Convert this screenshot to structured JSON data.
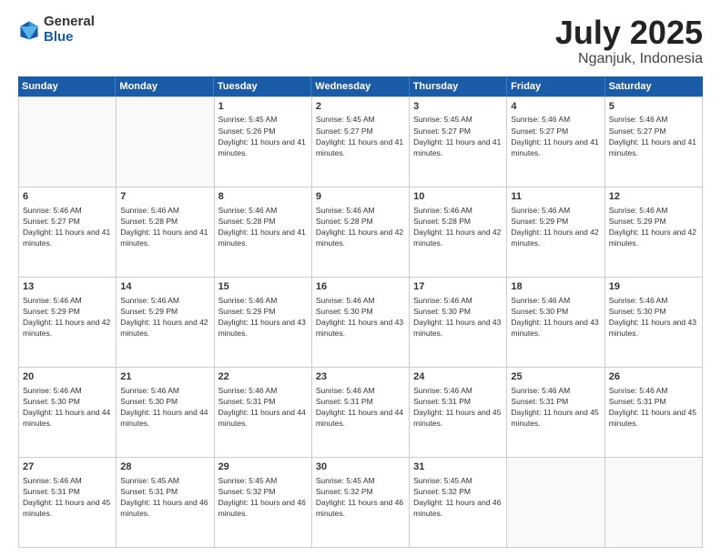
{
  "logo": {
    "general": "General",
    "blue": "Blue"
  },
  "title": "July 2025",
  "location": "Nganjuk, Indonesia",
  "weekdays": [
    "Sunday",
    "Monday",
    "Tuesday",
    "Wednesday",
    "Thursday",
    "Friday",
    "Saturday"
  ],
  "weeks": [
    [
      {
        "day": "",
        "empty": true
      },
      {
        "day": "",
        "empty": true
      },
      {
        "day": "1",
        "sunrise": "5:45 AM",
        "sunset": "5:26 PM",
        "daylight": "11 hours and 41 minutes."
      },
      {
        "day": "2",
        "sunrise": "5:45 AM",
        "sunset": "5:27 PM",
        "daylight": "11 hours and 41 minutes."
      },
      {
        "day": "3",
        "sunrise": "5:45 AM",
        "sunset": "5:27 PM",
        "daylight": "11 hours and 41 minutes."
      },
      {
        "day": "4",
        "sunrise": "5:46 AM",
        "sunset": "5:27 PM",
        "daylight": "11 hours and 41 minutes."
      },
      {
        "day": "5",
        "sunrise": "5:46 AM",
        "sunset": "5:27 PM",
        "daylight": "11 hours and 41 minutes."
      }
    ],
    [
      {
        "day": "6",
        "sunrise": "5:46 AM",
        "sunset": "5:27 PM",
        "daylight": "11 hours and 41 minutes."
      },
      {
        "day": "7",
        "sunrise": "5:46 AM",
        "sunset": "5:28 PM",
        "daylight": "11 hours and 41 minutes."
      },
      {
        "day": "8",
        "sunrise": "5:46 AM",
        "sunset": "5:28 PM",
        "daylight": "11 hours and 41 minutes."
      },
      {
        "day": "9",
        "sunrise": "5:46 AM",
        "sunset": "5:28 PM",
        "daylight": "11 hours and 42 minutes."
      },
      {
        "day": "10",
        "sunrise": "5:46 AM",
        "sunset": "5:28 PM",
        "daylight": "11 hours and 42 minutes."
      },
      {
        "day": "11",
        "sunrise": "5:46 AM",
        "sunset": "5:29 PM",
        "daylight": "11 hours and 42 minutes."
      },
      {
        "day": "12",
        "sunrise": "5:46 AM",
        "sunset": "5:29 PM",
        "daylight": "11 hours and 42 minutes."
      }
    ],
    [
      {
        "day": "13",
        "sunrise": "5:46 AM",
        "sunset": "5:29 PM",
        "daylight": "11 hours and 42 minutes."
      },
      {
        "day": "14",
        "sunrise": "5:46 AM",
        "sunset": "5:29 PM",
        "daylight": "11 hours and 42 minutes."
      },
      {
        "day": "15",
        "sunrise": "5:46 AM",
        "sunset": "5:29 PM",
        "daylight": "11 hours and 43 minutes."
      },
      {
        "day": "16",
        "sunrise": "5:46 AM",
        "sunset": "5:30 PM",
        "daylight": "11 hours and 43 minutes."
      },
      {
        "day": "17",
        "sunrise": "5:46 AM",
        "sunset": "5:30 PM",
        "daylight": "11 hours and 43 minutes."
      },
      {
        "day": "18",
        "sunrise": "5:46 AM",
        "sunset": "5:30 PM",
        "daylight": "11 hours and 43 minutes."
      },
      {
        "day": "19",
        "sunrise": "5:46 AM",
        "sunset": "5:30 PM",
        "daylight": "11 hours and 43 minutes."
      }
    ],
    [
      {
        "day": "20",
        "sunrise": "5:46 AM",
        "sunset": "5:30 PM",
        "daylight": "11 hours and 44 minutes."
      },
      {
        "day": "21",
        "sunrise": "5:46 AM",
        "sunset": "5:30 PM",
        "daylight": "11 hours and 44 minutes."
      },
      {
        "day": "22",
        "sunrise": "5:46 AM",
        "sunset": "5:31 PM",
        "daylight": "11 hours and 44 minutes."
      },
      {
        "day": "23",
        "sunrise": "5:46 AM",
        "sunset": "5:31 PM",
        "daylight": "11 hours and 44 minutes."
      },
      {
        "day": "24",
        "sunrise": "5:46 AM",
        "sunset": "5:31 PM",
        "daylight": "11 hours and 45 minutes."
      },
      {
        "day": "25",
        "sunrise": "5:46 AM",
        "sunset": "5:31 PM",
        "daylight": "11 hours and 45 minutes."
      },
      {
        "day": "26",
        "sunrise": "5:46 AM",
        "sunset": "5:31 PM",
        "daylight": "11 hours and 45 minutes."
      }
    ],
    [
      {
        "day": "27",
        "sunrise": "5:46 AM",
        "sunset": "5:31 PM",
        "daylight": "11 hours and 45 minutes."
      },
      {
        "day": "28",
        "sunrise": "5:45 AM",
        "sunset": "5:31 PM",
        "daylight": "11 hours and 46 minutes."
      },
      {
        "day": "29",
        "sunrise": "5:45 AM",
        "sunset": "5:32 PM",
        "daylight": "11 hours and 46 minutes."
      },
      {
        "day": "30",
        "sunrise": "5:45 AM",
        "sunset": "5:32 PM",
        "daylight": "11 hours and 46 minutes."
      },
      {
        "day": "31",
        "sunrise": "5:45 AM",
        "sunset": "5:32 PM",
        "daylight": "11 hours and 46 minutes."
      },
      {
        "day": "",
        "empty": true
      },
      {
        "day": "",
        "empty": true
      }
    ]
  ]
}
